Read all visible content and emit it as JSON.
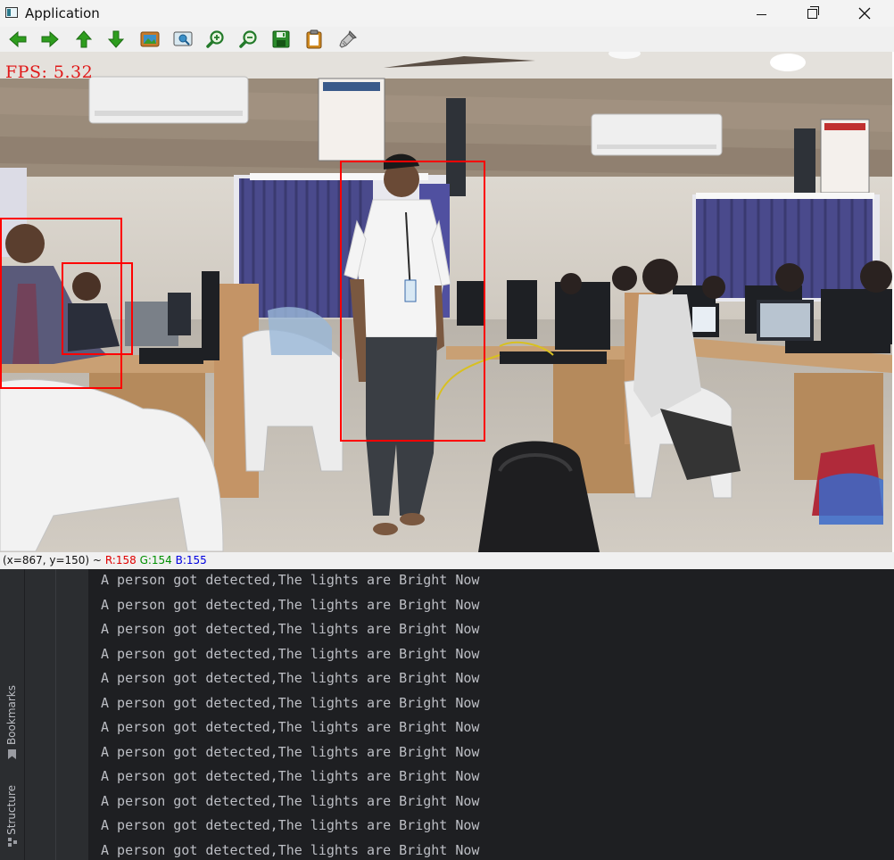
{
  "window": {
    "title": "Application",
    "minimize_icon": "minimize-icon",
    "maximize_icon": "restore-icon",
    "close_icon": "close-icon"
  },
  "toolbar": {
    "buttons": [
      {
        "icon": "pan-left-icon"
      },
      {
        "icon": "pan-right-icon"
      },
      {
        "icon": "pan-up-icon"
      },
      {
        "icon": "pan-down-icon"
      },
      {
        "icon": "zoom-actual-icon"
      },
      {
        "icon": "zoom-fit-icon"
      },
      {
        "icon": "zoom-in-icon"
      },
      {
        "icon": "zoom-out-icon"
      },
      {
        "icon": "save-icon"
      },
      {
        "icon": "copy-icon"
      },
      {
        "icon": "properties-icon"
      }
    ],
    "colors": {
      "arrow": "#2e9d1e",
      "zoom": "#237a2a",
      "save": "#2a8a2a",
      "copy": "#d08a20"
    }
  },
  "canvas": {
    "fps_text": "FPS: 5.32",
    "fps_color": "#e01818",
    "box_color": "#ff0000"
  },
  "status": {
    "coords": "(x=867, y=150) ~",
    "r": "R:158",
    "g": "G:154",
    "b": "B:155"
  },
  "ide": {
    "side_tabs": [
      "Bookmarks",
      "Structure"
    ],
    "console_lines": [
      "A person got detected,The lights are Bright Now",
      "A person got detected,The lights are Bright Now",
      "A person got detected,The lights are Bright Now",
      "A person got detected,The lights are Bright Now",
      "A person got detected,The lights are Bright Now",
      "A person got detected,The lights are Bright Now",
      "A person got detected,The lights are Bright Now",
      "A person got detected,The lights are Bright Now",
      "A person got detected,The lights are Bright Now",
      "A person got detected,The lights are Bright Now",
      "A person got detected,The lights are Bright Now",
      "A person got detected,The lights are Bright Now"
    ]
  }
}
